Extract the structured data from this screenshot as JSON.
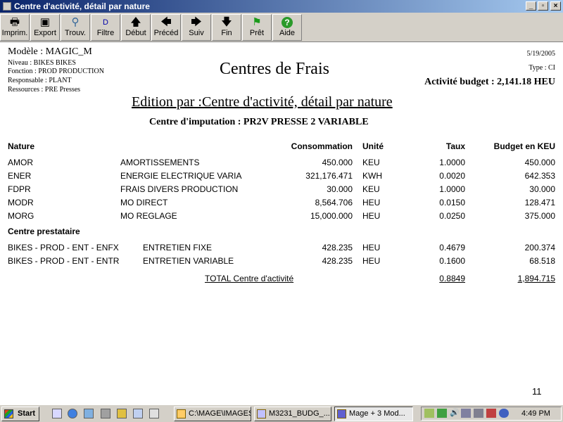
{
  "window": {
    "title": "Centre d'activité, détail par nature"
  },
  "toolbar": {
    "buttons": [
      {
        "label": "Imprim.",
        "icon": "printer-icon"
      },
      {
        "label": "Export",
        "icon": "floppy-disk-icon"
      },
      {
        "label": "Trouv.",
        "icon": "binoculars-icon"
      },
      {
        "label": "Filtre",
        "icon": "filter-icon"
      },
      {
        "label": "Début",
        "icon": "arrow-up-icon"
      },
      {
        "label": "Précéd",
        "icon": "arrow-left-icon"
      },
      {
        "label": "Suiv",
        "icon": "arrow-right-icon"
      },
      {
        "label": "Fin",
        "icon": "arrow-down-icon"
      },
      {
        "label": "Prêt",
        "icon": "flag-icon"
      },
      {
        "label": "Aide",
        "icon": "help-icon"
      }
    ]
  },
  "report": {
    "model": "Modèle : MAGIC_M",
    "niveau": "Niveau : BIKES  BIKES",
    "fonction": "Fonction : PROD  PRODUCTION",
    "responsable": "Responsable : PLANT",
    "ressources": "Ressources : PRE  Presses",
    "title": "Centres de Frais",
    "date": "5/19/2005",
    "type": "Type : CI",
    "activite_budget": "Activité budget : 2,141.18 HEU",
    "edition": "Edition par :Centre d'activité, détail par nature",
    "centre_imputation": "Centre d'imputation : PR2V  PRESSE 2 VARIABLE",
    "headers": {
      "nature": "Nature",
      "consommation": "Consommation",
      "unite": "Unité",
      "taux": "Taux",
      "budget": "Budget en KEU"
    },
    "rows": [
      {
        "code": "AMOR",
        "desc": "AMORTISSEMENTS",
        "conso": "450.000",
        "unite": "KEU",
        "taux": "1.0000",
        "budget": "450.000"
      },
      {
        "code": "ENER",
        "desc": "ENERGIE ELECTRIQUE VARIA",
        "conso": "321,176.471",
        "unite": "KWH",
        "taux": "0.0020",
        "budget": "642.353"
      },
      {
        "code": "FDPR",
        "desc": "FRAIS DIVERS PRODUCTION",
        "conso": "30.000",
        "unite": "KEU",
        "taux": "1.0000",
        "budget": "30.000"
      },
      {
        "code": "MODR",
        "desc": "MO DIRECT",
        "conso": "8,564.706",
        "unite": "HEU",
        "taux": "0.0150",
        "budget": "128.471"
      },
      {
        "code": "MORG",
        "desc": "MO REGLAGE",
        "conso": "15,000.000",
        "unite": "HEU",
        "taux": "0.0250",
        "budget": "375.000"
      }
    ],
    "centre_prestataire": "Centre prestataire",
    "prestataire_rows": [
      {
        "code": "BIKES - PROD - ENT - ENFX",
        "desc": "ENTRETIEN FIXE",
        "conso": "428.235",
        "unite": "HEU",
        "taux": "0.4679",
        "budget": "200.374"
      },
      {
        "code": "BIKES - PROD - ENT - ENTR",
        "desc": "ENTRETIEN VARIABLE",
        "conso": "428.235",
        "unite": "HEU",
        "taux": "0.1600",
        "budget": "68.518"
      }
    ],
    "total": {
      "label": "TOTAL   Centre d'activité",
      "taux": "0.8849",
      "budget": "1,894.715"
    },
    "page_number": "11"
  },
  "taskbar": {
    "start": "Start",
    "tasks": [
      {
        "label": "C:\\MAGE\\IMAGES"
      },
      {
        "label": "M3231_BUDG_..."
      },
      {
        "label": "Mage + 3   Mod..."
      }
    ],
    "clock": "4:49 PM"
  }
}
